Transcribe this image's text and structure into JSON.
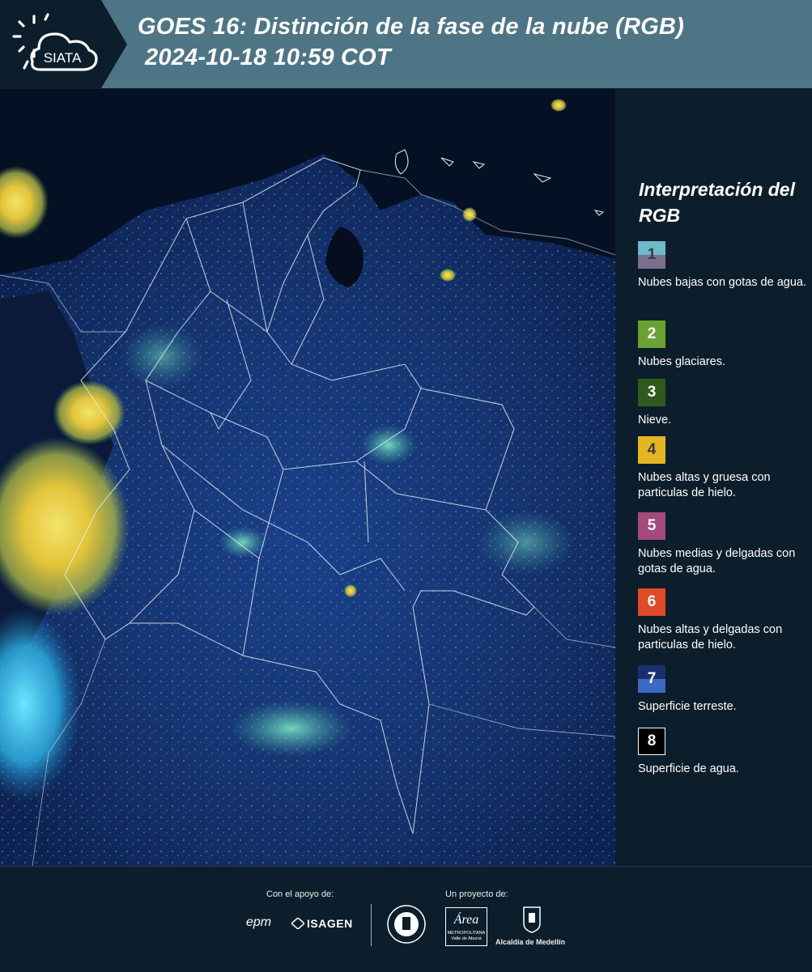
{
  "header": {
    "title_line1": "GOES 16: Distinción de la fase de la nube (RGB)",
    "title_line2": "2024-10-18 10:59 COT",
    "logo_text": "SIATA"
  },
  "legend": {
    "title": "Interpretación del RGB",
    "items": [
      {
        "num": "1",
        "label": "Nubes bajas con gotas de agua.",
        "color_top": "#6fb8c9",
        "color_bottom": "#7b6f8e"
      },
      {
        "num": "2",
        "label": "Nubes glaciares.",
        "color": "#6aa232"
      },
      {
        "num": "3",
        "label": "Nieve.",
        "color": "#2f5a1e"
      },
      {
        "num": "4",
        "label": "Nubes altas y gruesa con particulas de hielo.",
        "color": "#e2b522"
      },
      {
        "num": "5",
        "label": "Nubes medias y delgadas con gotas de agua.",
        "color": "#a24a7c"
      },
      {
        "num": "6",
        "label": "Nubes altas y delgadas con particulas de hielo.",
        "color": "#df4a28"
      },
      {
        "num": "7",
        "label": "Superficie terreste.",
        "color_top": "#1b2f6e",
        "color_bottom": "#3c69c4"
      },
      {
        "num": "8",
        "label": "Superficie de agua.",
        "color": "#000000"
      }
    ]
  },
  "footer": {
    "support_label": "Con el apoyo de:",
    "project_label": "Un proyecto de:",
    "sponsors": [
      "epm",
      "ISAGEN"
    ],
    "partners": [
      "METROPOLITANA Valle de Aburrá",
      "Alcaldía de Medellín"
    ],
    "area_mark": "Área"
  }
}
